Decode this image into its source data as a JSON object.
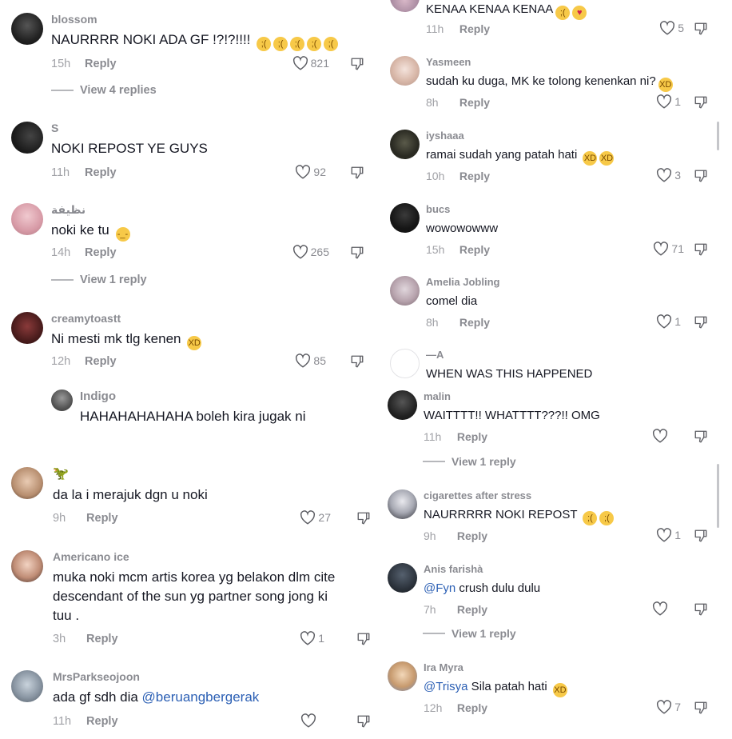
{
  "left": {
    "c1": {
      "user": "blossom",
      "text": "NAURRRR NOKI ADA GF !?!?!!!! ",
      "emojis": [
        "😭",
        "😭",
        "😭",
        "😭",
        "😭"
      ],
      "time": "15h",
      "reply": "Reply",
      "likes": "821",
      "view": "View 4 replies"
    },
    "c2": {
      "user": "S",
      "text": "NOKI REPOST YE GUYS",
      "time": "11h",
      "reply": "Reply",
      "likes": "92"
    },
    "c3": {
      "user": "نظيفة",
      "text": "noki ke tu ",
      "emojis": [
        "😔"
      ],
      "time": "14h",
      "reply": "Reply",
      "likes": "265",
      "view": "View 1 reply"
    },
    "c4": {
      "user": "creamytoastt",
      "text": "Ni mesti mk tlg kenen ",
      "emojis": [
        "😂"
      ],
      "time": "12h",
      "reply": "Reply",
      "likes": "85"
    },
    "c4r": {
      "user": "Indigo",
      "text": "HAHAHAHAHAHA boleh kira jugak ni"
    },
    "c5": {
      "user": "🦖",
      "text": "da la i merajuk dgn u noki",
      "time": "9h",
      "reply": "Reply",
      "likes": "27"
    },
    "c6": {
      "user": "Americano ice",
      "text1": "muka noki mcm artis korea yg belakon dlm cite",
      "text2": "descendant of the sun yg partner song jong ki",
      "text3": "tuu .",
      "time": "3h",
      "reply": "Reply",
      "likes": "1"
    },
    "c7": {
      "user": "MrsParkseojoon",
      "text": "ada gf sdh dia ",
      "mention": "@beruangbergerak",
      "time": "11h",
      "reply": "Reply"
    }
  },
  "right": {
    "r0": {
      "text": "KENAA KENAA KENAA",
      "emojis": [
        "😭",
        "😍"
      ],
      "time": "11h",
      "reply": "Reply",
      "likes": "5"
    },
    "r1": {
      "user": "Yasmeen",
      "text": "sudah ku duga, MK ke tolong kenenkan ni?",
      "emojis": [
        "😂"
      ],
      "time": "8h",
      "reply": "Reply",
      "likes": "1"
    },
    "r2": {
      "user": "iyshaaa",
      "text": "ramai sudah yang patah hati ",
      "emojis": [
        "🤣",
        "🤣"
      ],
      "time": "10h",
      "reply": "Reply",
      "likes": "3"
    },
    "r3": {
      "user": "bucs",
      "text": "wowowowww",
      "time": "15h",
      "reply": "Reply",
      "likes": "71"
    },
    "r4": {
      "user": "Amelia Jobling",
      "text": "comel dia",
      "time": "8h",
      "reply": "Reply",
      "likes": "1"
    },
    "r5": {
      "user": "—A",
      "text": "WHEN WAS THIS HAPPENED"
    },
    "r6": {
      "user": "malin",
      "text": "WAITTTT!! WHATTTT???!! OMG",
      "time": "11h",
      "reply": "Reply",
      "view": "View 1 reply"
    },
    "r7": {
      "user": "cigarettes after stress",
      "text": "NAURRRRR NOKI REPOST ",
      "emojis": [
        "😭",
        "😭"
      ],
      "time": "9h",
      "reply": "Reply",
      "likes": "1"
    },
    "r8": {
      "user": "Anis farishà",
      "mention": "@Fyn",
      "text": " crush dulu dulu",
      "time": "7h",
      "reply": "Reply",
      "view": "View 1 reply"
    },
    "r9": {
      "user": "Ira Myra",
      "mention": "@Trisya",
      "text": " Sila patah hati ",
      "emojis": [
        "😂"
      ],
      "time": "12h",
      "reply": "Reply",
      "likes": "7"
    }
  },
  "colors": {
    "text": "#161823",
    "muted": "#8a8b91",
    "mention": "#2b5fb4",
    "emoji": "#f7c948"
  },
  "icons": [
    "heart-icon",
    "dislike-icon"
  ]
}
